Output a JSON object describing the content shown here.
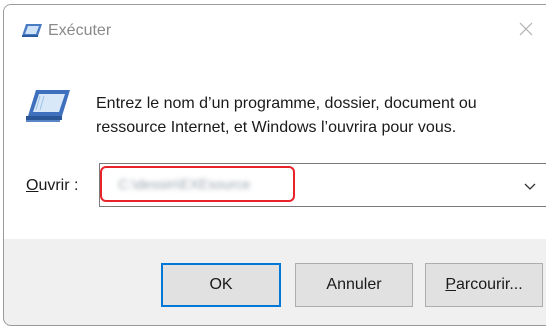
{
  "window": {
    "title": "Exécuter",
    "close_glyph": "✕"
  },
  "description": "Entrez le nom d’un programme, dossier, document ou ressource Internet, et Windows l’ouvrira pour vous.",
  "open_field": {
    "label_accel": "O",
    "label_rest": "uvrir :",
    "value": "C:\\dessin\\EXEsource",
    "highlight_color": "#e8242a"
  },
  "buttons": {
    "ok": "OK",
    "cancel": "Annuler",
    "browse_accel": "P",
    "browse_rest": "arcourir..."
  },
  "icons": {
    "title": "run-dialog-icon",
    "content": "run-dialog-icon",
    "dropdown": "chevron-down-icon",
    "close": "close-icon"
  },
  "colors": {
    "focus_border": "#0078d7",
    "button_face": "#e1e1e1"
  }
}
